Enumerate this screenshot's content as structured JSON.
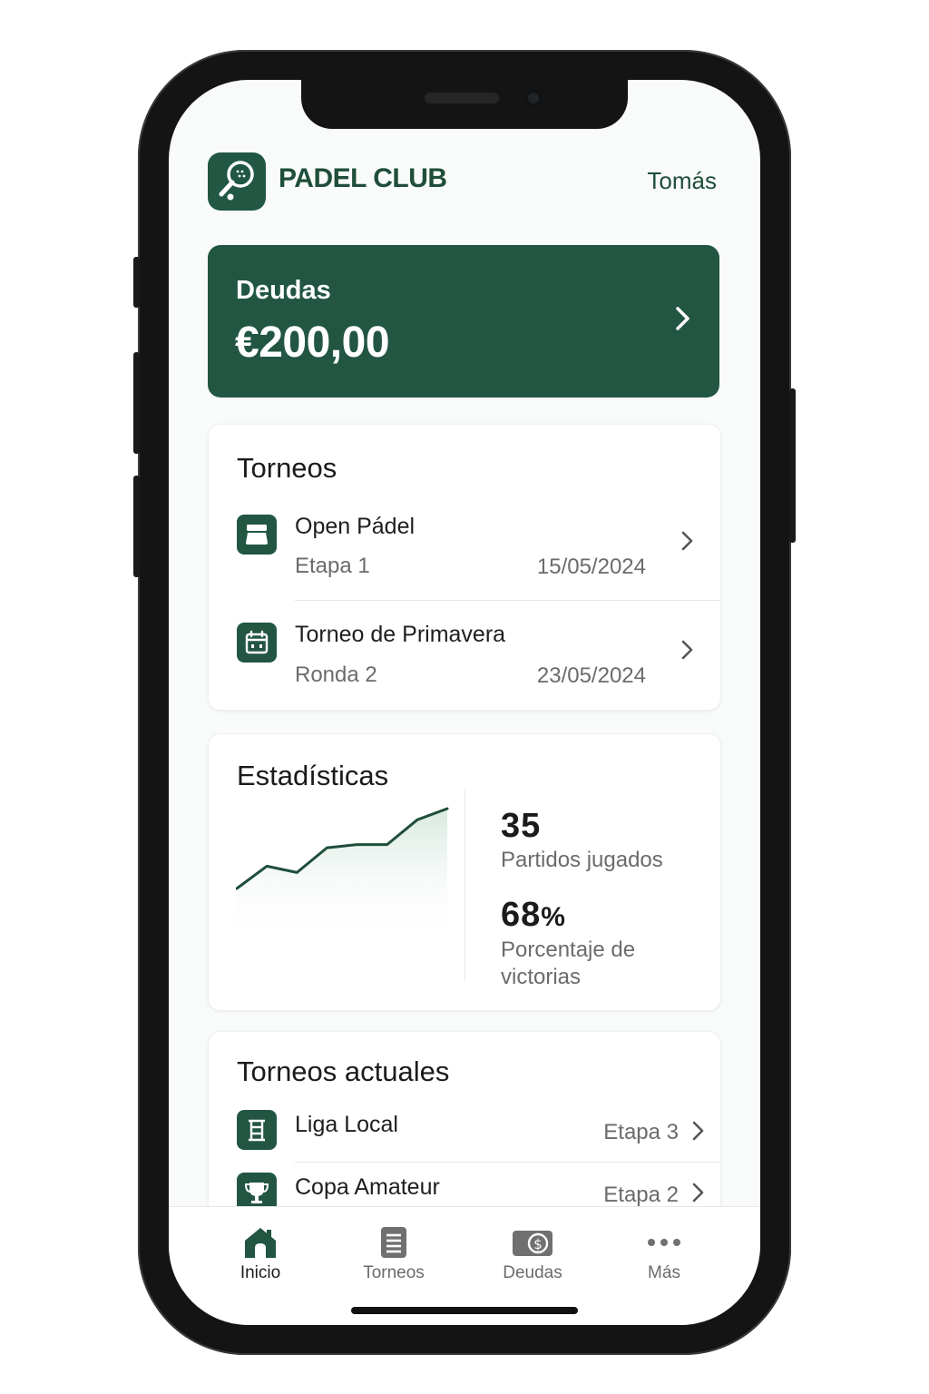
{
  "header": {
    "brand": "PADEL CLUB",
    "user": "Tomás"
  },
  "debt": {
    "label": "Deudas",
    "amount": "€200,00"
  },
  "tournaments": {
    "title": "Torneos",
    "items": [
      {
        "name": "Open Pádel",
        "stage": "Etapa 1",
        "date": "15/05/2024",
        "icon": "tournament-icon"
      },
      {
        "name": "Torneo de Primavera",
        "stage": "Ronda 2",
        "date": "23/05/2024",
        "icon": "calendar-icon"
      }
    ]
  },
  "stats": {
    "title": "Estadísticas",
    "matches_value": "35",
    "matches_label": "Partidos jugados",
    "win_value": "68",
    "win_unit": "%",
    "win_label": "Porcentaje de victorias",
    "trend": [
      0,
      0.28,
      0.2,
      0.51,
      0.55,
      0.55,
      0.86,
      1.0
    ]
  },
  "current": {
    "title": "Torneos actuales",
    "items": [
      {
        "name": "Liga Local",
        "stage": "Etapa 3",
        "icon": "ladder-icon"
      },
      {
        "name": "Copa Amateur",
        "stage": "Etapa 2",
        "icon": "trophy-icon"
      }
    ]
  },
  "tabs": [
    {
      "label": "Inicio",
      "icon": "home-icon",
      "active": true
    },
    {
      "label": "Torneos",
      "icon": "list-icon",
      "active": false
    },
    {
      "label": "Deudas",
      "icon": "money-icon",
      "active": false
    },
    {
      "label": "Más",
      "icon": "more-icon",
      "active": false
    }
  ],
  "colors": {
    "primary": "#225642",
    "text": "#1b1b1b",
    "muted": "#6b6b6b",
    "background": "#f9fbfa"
  }
}
